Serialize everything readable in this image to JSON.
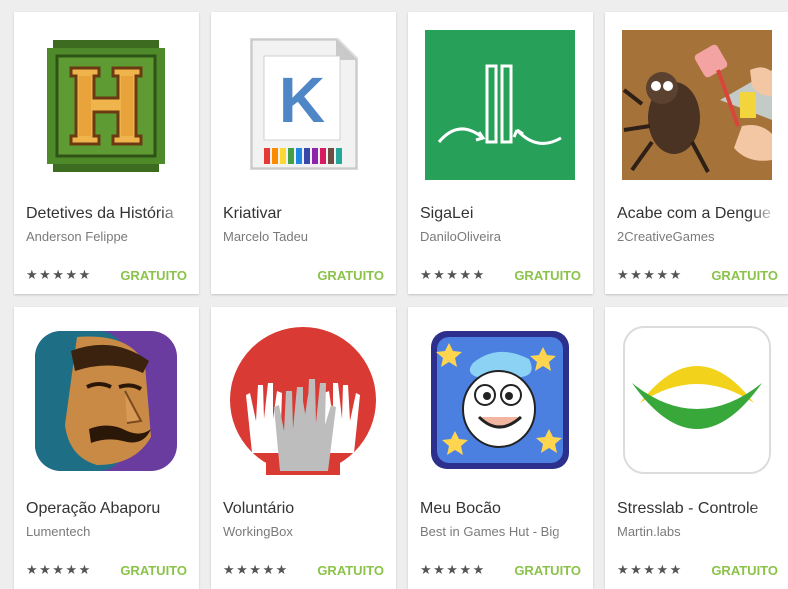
{
  "colors": {
    "background": "#eeeeee",
    "card": "#ffffff",
    "free_label": "#8bc34a",
    "title_text": "#333333",
    "developer_text": "#7a7a7a"
  },
  "apps": [
    {
      "title": "Detetives da História",
      "developer": "Anderson Felippe",
      "rating": 5,
      "rating_glyphs": "★★★★★",
      "price": "GRATUITO",
      "icon": "wooden-letter-h-icon"
    },
    {
      "title": "Kriativar",
      "developer": "Marcelo Tadeu",
      "rating": null,
      "rating_glyphs": "",
      "price": "GRATUITO",
      "icon": "letter-k-page-with-colored-pencils-icon",
      "icon_letter": "K"
    },
    {
      "title": "SigaLei",
      "developer": "DaniloOliveira",
      "rating": 4.5,
      "rating_glyphs": "★★★★★",
      "price": "GRATUITO",
      "icon": "green-congress-towers-icon"
    },
    {
      "title": "Acabe com a Dengue",
      "developer": "2CreativeGames",
      "rating": 5,
      "rating_glyphs": "★★★★★",
      "price": "GRATUITO",
      "icon": "mosquito-spray-flyswatter-icon"
    },
    {
      "title": "Operação Abaporu",
      "developer": "Lumentech",
      "rating": 5,
      "rating_glyphs": "★★★★★",
      "price": "GRATUITO",
      "icon": "mustached-detective-face-icon"
    },
    {
      "title": "Voluntário",
      "developer": "WorkingBox",
      "rating": 5,
      "rating_glyphs": "★★★★★",
      "price": "GRATUITO",
      "icon": "raised-hands-circle-icon"
    },
    {
      "title": "Meu Bocão",
      "developer": "Best in Games Hut - Big",
      "rating": 5,
      "rating_glyphs": "★★★★★",
      "price": "GRATUITO",
      "icon": "cartoon-big-mouth-character-icon"
    },
    {
      "title": "Stresslab - Controle",
      "developer": "Martin.labs",
      "rating": 5,
      "rating_glyphs": "★★★★★",
      "price": "GRATUITO",
      "icon": "green-yellow-arcs-icon"
    }
  ]
}
